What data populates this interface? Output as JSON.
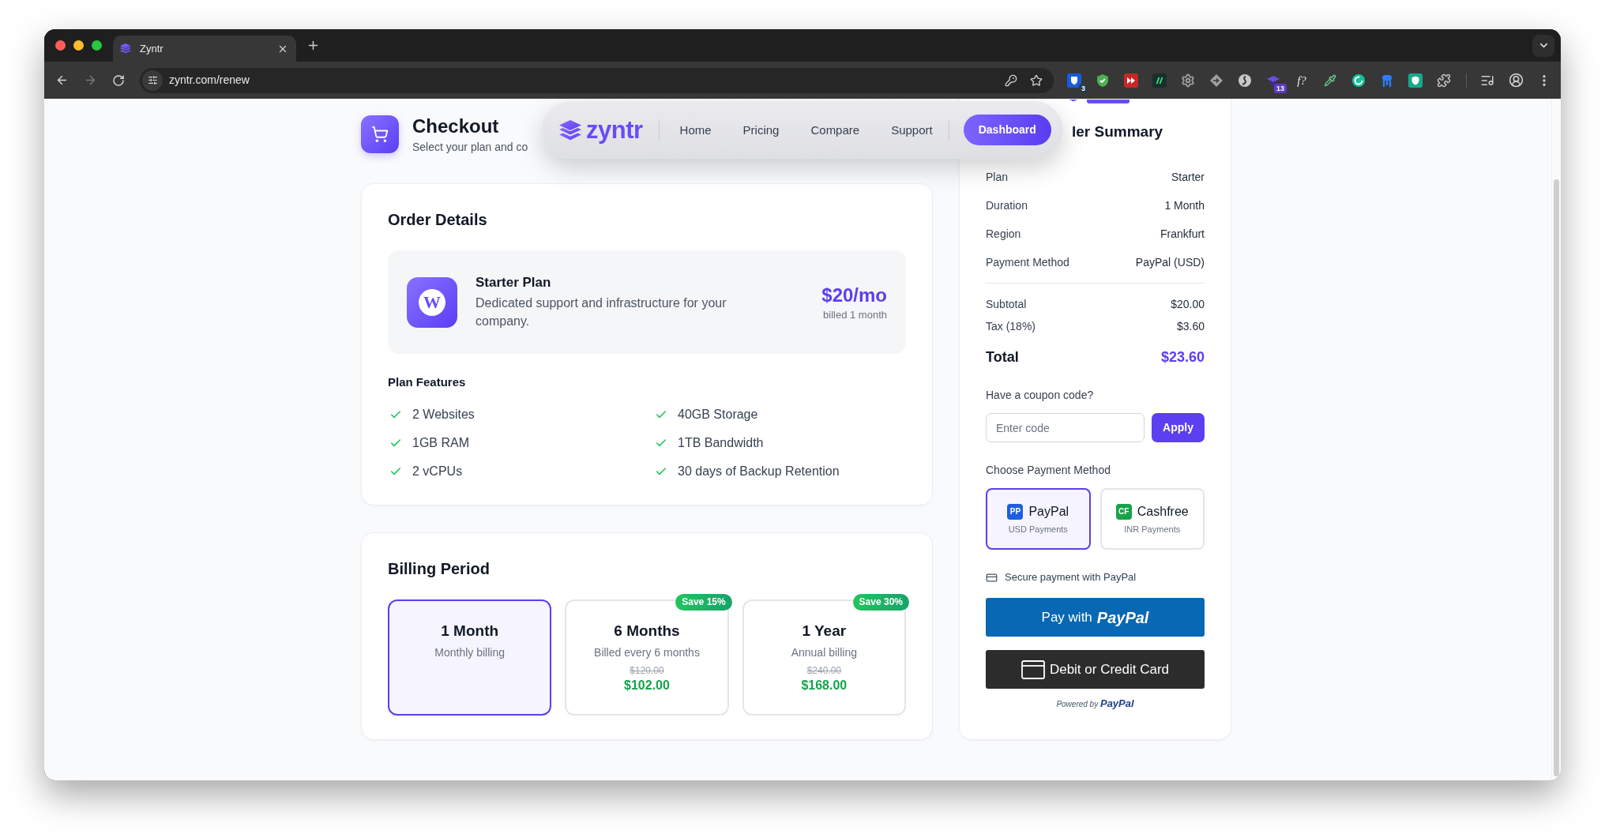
{
  "browser": {
    "tab": {
      "title": "Zyntr"
    },
    "url": "zyntr.com/renew",
    "extensions": [
      {
        "kind": "vault",
        "badge": "3"
      },
      {
        "kind": "shield"
      },
      {
        "kind": "forward"
      },
      {
        "kind": "slashes"
      },
      {
        "kind": "gear"
      },
      {
        "kind": "diamond"
      },
      {
        "kind": "swirl"
      },
      {
        "kind": "cap",
        "badge": "13"
      },
      {
        "kind": "glyph",
        "glyph": "f?"
      },
      {
        "kind": "dropper"
      },
      {
        "kind": "ring"
      },
      {
        "kind": "figure"
      },
      {
        "kind": "tile-shield"
      },
      {
        "kind": "puzzle"
      }
    ]
  },
  "header": {
    "title": "Checkout",
    "subtitle": "Select your plan and co"
  },
  "nav": {
    "brand": "zyntr",
    "links": [
      {
        "label": "Home"
      },
      {
        "label": "Pricing"
      },
      {
        "label": "Compare"
      },
      {
        "label": "Support"
      }
    ],
    "cta": "Dashboard"
  },
  "order_details": {
    "title": "Order Details",
    "plan": {
      "logo": "W",
      "name": "Starter Plan",
      "description": "Dedicated support and infrastructure for your company.",
      "price": "$20/mo",
      "billing": "billed 1 month"
    },
    "features_title": "Plan Features",
    "features": [
      "2 Websites",
      "40GB Storage",
      "1GB RAM",
      "1TB Bandwidth",
      "2 vCPUs",
      "30 days of Backup Retention"
    ]
  },
  "billing_period": {
    "title": "Billing Period",
    "options": [
      {
        "label": "1 Month",
        "description": "Monthly billing",
        "selected": true
      },
      {
        "label": "6 Months",
        "description": "Billed every 6 months",
        "badge": "Save 15%",
        "original_price": "$120.00",
        "price": "$102.00",
        "selected": false
      },
      {
        "label": "1 Year",
        "description": "Annual billing",
        "badge": "Save 30%",
        "original_price": "$240.00",
        "price": "$168.00",
        "selected": false
      }
    ]
  },
  "order_summary": {
    "title": "ler Summary",
    "details": [
      {
        "label": "Plan",
        "value": "Starter"
      },
      {
        "label": "Duration",
        "value": "1 Month"
      },
      {
        "label": "Region",
        "value": "Frankfurt"
      },
      {
        "label": "Payment Method",
        "value": "PayPal (USD)"
      }
    ],
    "charges": [
      {
        "label": "Subtotal",
        "value": "$20.00"
      },
      {
        "label": "Tax (18%)",
        "value": "$3.60"
      }
    ],
    "total": {
      "label": "Total",
      "value": "$23.60"
    },
    "coupon": {
      "label": "Have a coupon code?",
      "placeholder": "Enter code",
      "button": "Apply"
    },
    "payment": {
      "label": "Choose Payment Method",
      "methods": [
        {
          "badge": "PP",
          "color": "#1d5fe0",
          "name": "PayPal",
          "note": "USD Payments",
          "selected": true
        },
        {
          "badge": "CF",
          "color": "#16a34a",
          "name": "Cashfree",
          "note": "INR Payments",
          "selected": false
        }
      ]
    },
    "secure_note": "Secure payment with PayPal",
    "paypal_button": {
      "label": "Pay with",
      "brand": "PayPal"
    },
    "card_button": "Debit or Credit Card",
    "powered_by": {
      "label": "Powered by",
      "brand": "PayPal"
    }
  }
}
